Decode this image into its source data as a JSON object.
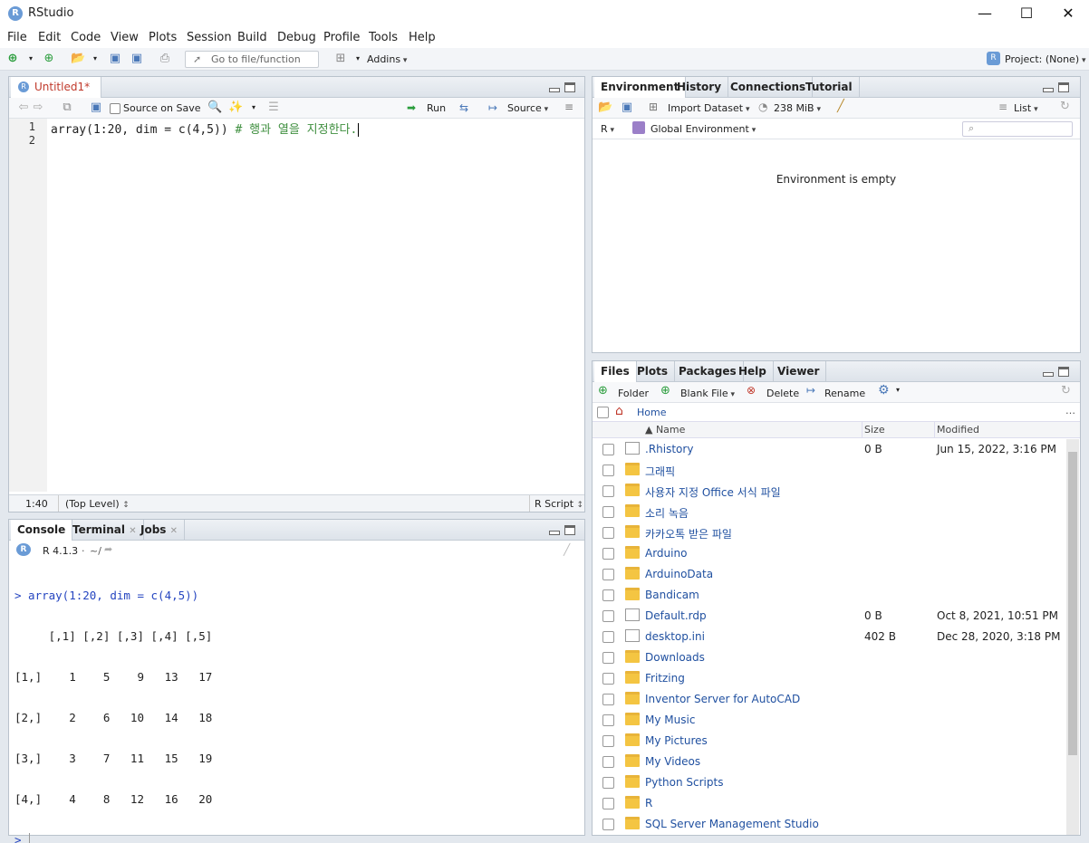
{
  "window": {
    "title": "RStudio",
    "logo": "R"
  },
  "menu": [
    "File",
    "Edit",
    "Code",
    "View",
    "Plots",
    "Session",
    "Build",
    "Debug",
    "Profile",
    "Tools",
    "Help"
  ],
  "toolbar": {
    "goto_placeholder": "Go to file/function",
    "addins": "Addins",
    "project": "Project: (None)"
  },
  "editor": {
    "tab": "Untitled1*",
    "source_on_save": "Source on Save",
    "run": "Run",
    "source": "Source",
    "lines": [
      {
        "n": "1",
        "code": "array(1:20, dim = c(4,5))",
        "comment": " # 행과 열을 지정한다."
      },
      {
        "n": "2",
        "code": "",
        "comment": ""
      }
    ],
    "status_pos": "1:40",
    "status_scope": "(Top Level)",
    "status_type": "R Script"
  },
  "console": {
    "tabs": [
      "Console",
      "Terminal",
      "Jobs"
    ],
    "version": "R 4.1.3",
    "path": "~/",
    "lines": [
      "> array(1:20, dim = c(4,5))",
      "     [,1] [,2] [,3] [,4] [,5]",
      "[1,]    1    5    9   13   17",
      "[2,]    2    6   10   14   18",
      "[3,]    3    7   11   15   19",
      "[4,]    4    8   12   16   20",
      "> "
    ]
  },
  "environment": {
    "tabs": [
      "Environment",
      "History",
      "Connections",
      "Tutorial"
    ],
    "import_dataset": "Import Dataset",
    "memory": "238 MiB",
    "list": "List",
    "lang": "R",
    "scope": "Global Environment",
    "empty_message": "Environment is empty"
  },
  "files": {
    "tabs": [
      "Files",
      "Plots",
      "Packages",
      "Help",
      "Viewer"
    ],
    "folder_btn": "Folder",
    "blank_file": "Blank File",
    "delete": "Delete",
    "rename": "Rename",
    "breadcrumb": "Home",
    "columns": {
      "name": "▲ Name",
      "size": "Size",
      "modified": "Modified"
    },
    "rows": [
      {
        "name": ".Rhistory",
        "size": "0 B",
        "modified": "Jun 15, 2022, 3:16 PM",
        "icon": "history-file"
      },
      {
        "name": "그래픽",
        "size": "",
        "modified": "",
        "icon": "folder"
      },
      {
        "name": "사용자 지정 Office 서식 파일",
        "size": "",
        "modified": "",
        "icon": "folder"
      },
      {
        "name": "소리 녹음",
        "size": "",
        "modified": "",
        "icon": "folder"
      },
      {
        "name": "카카오톡 받은 파일",
        "size": "",
        "modified": "",
        "icon": "folder"
      },
      {
        "name": "Arduino",
        "size": "",
        "modified": "",
        "icon": "folder"
      },
      {
        "name": "ArduinoData",
        "size": "",
        "modified": "",
        "icon": "folder"
      },
      {
        "name": "Bandicam",
        "size": "",
        "modified": "",
        "icon": "folder"
      },
      {
        "name": "Default.rdp",
        "size": "0 B",
        "modified": "Oct 8, 2021, 10:51 PM",
        "icon": "file"
      },
      {
        "name": "desktop.ini",
        "size": "402 B",
        "modified": "Dec 28, 2020, 3:18 PM",
        "icon": "settings-file"
      },
      {
        "name": "Downloads",
        "size": "",
        "modified": "",
        "icon": "folder"
      },
      {
        "name": "Fritzing",
        "size": "",
        "modified": "",
        "icon": "folder"
      },
      {
        "name": "Inventor Server for AutoCAD",
        "size": "",
        "modified": "",
        "icon": "folder"
      },
      {
        "name": "My Music",
        "size": "",
        "modified": "",
        "icon": "folder"
      },
      {
        "name": "My Pictures",
        "size": "",
        "modified": "",
        "icon": "folder"
      },
      {
        "name": "My Videos",
        "size": "",
        "modified": "",
        "icon": "folder"
      },
      {
        "name": "Python Scripts",
        "size": "",
        "modified": "",
        "icon": "folder"
      },
      {
        "name": "R",
        "size": "",
        "modified": "",
        "icon": "folder"
      },
      {
        "name": "SQL Server Management Studio",
        "size": "",
        "modified": "",
        "icon": "folder"
      }
    ]
  }
}
